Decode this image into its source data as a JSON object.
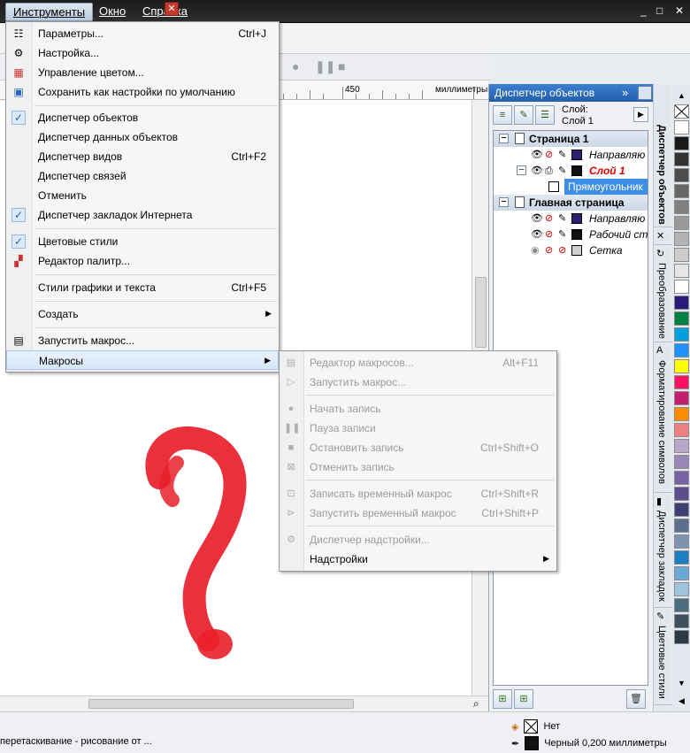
{
  "menubar": {
    "items": [
      "Инструменты",
      "Окно",
      "Справка"
    ],
    "controls": [
      "_",
      "□",
      "✕"
    ]
  },
  "ruler": {
    "mark": "450",
    "unit": "миллиметры"
  },
  "tools_menu": {
    "items": [
      {
        "label": "Параметры...",
        "shortcut": "Ctrl+J",
        "icon": "options-icon"
      },
      {
        "label": "Настройка...",
        "shortcut": "",
        "icon": "customize-icon"
      },
      {
        "label": "Управление цветом...",
        "shortcut": "",
        "icon": "color-management-icon"
      },
      {
        "label": "Сохранить как настройки по умолчанию",
        "shortcut": "",
        "icon": "save-defaults-icon"
      },
      {
        "label": "Диспетчер объектов",
        "shortcut": "",
        "icon": "check-icon",
        "checked": true
      },
      {
        "label": "Диспетчер данных объектов",
        "shortcut": ""
      },
      {
        "label": "Диспетчер видов",
        "shortcut": "Ctrl+F2"
      },
      {
        "label": "Диспетчер связей",
        "shortcut": ""
      },
      {
        "label": "Отменить",
        "shortcut": ""
      },
      {
        "label": "Диспетчер закладок Интернета",
        "shortcut": "",
        "icon": "check-icon",
        "checked": true
      },
      {
        "label": "Цветовые стили",
        "shortcut": "",
        "icon": "check-icon",
        "checked": true
      },
      {
        "label": "Редактор палитр...",
        "shortcut": "",
        "icon": "palette-editor-icon"
      },
      {
        "label": "Стили графики и текста",
        "shortcut": "Ctrl+F5"
      },
      {
        "label": "Создать",
        "shortcut": "",
        "submenu": true
      },
      {
        "label": "Запустить макрос...",
        "shortcut": "",
        "icon": "run-macro-icon"
      },
      {
        "label": "Макросы",
        "shortcut": "",
        "submenu": true
      }
    ]
  },
  "macro_menu": {
    "items": [
      {
        "label": "Редактор макросов...",
        "shortcut": "Alt+F11",
        "icon": "macro-editor-icon"
      },
      {
        "label": "Запустить макрос...",
        "shortcut": "",
        "icon": "play-icon"
      },
      {
        "label": "Начать запись",
        "shortcut": "",
        "icon": "record-icon"
      },
      {
        "label": "Пауза записи",
        "shortcut": "",
        "icon": "pause-icon"
      },
      {
        "label": "Остановить запись",
        "shortcut": "Ctrl+Shift+O",
        "icon": "stop-icon"
      },
      {
        "label": "Отменить запись",
        "shortcut": "",
        "icon": "cancel-record-icon"
      },
      {
        "label": "Записать временный макрос",
        "shortcut": "Ctrl+Shift+R",
        "icon": "record-temp-icon"
      },
      {
        "label": "Запустить временный макрос",
        "shortcut": "Ctrl+Shift+P",
        "icon": "run-temp-icon"
      },
      {
        "label": "Диспетчер надстройки...",
        "shortcut": "",
        "icon": "addon-manager-icon"
      },
      {
        "label": "Надстройки",
        "shortcut": "",
        "submenu": true
      }
    ]
  },
  "docker": {
    "title": "Диспетчер объектов",
    "layer_caption": "Слой:",
    "layer_name": "Слой 1",
    "tree": [
      {
        "type": "page",
        "label": "Страница 1"
      },
      {
        "type": "layer",
        "label": "Направляю",
        "color": "#2b1f73"
      },
      {
        "type": "layer",
        "label": "Слой 1",
        "color": "#111111",
        "active": true
      },
      {
        "type": "object",
        "label": "Прямоугольник",
        "selected": true
      },
      {
        "type": "page",
        "label": "Главная страница"
      },
      {
        "type": "layer",
        "label": "Направляю",
        "color": "#2b1f73"
      },
      {
        "type": "layer",
        "label": "Рабочий ст",
        "color": "#111111"
      },
      {
        "type": "layer",
        "label": "Сетка",
        "color": "#cfcfcf"
      }
    ]
  },
  "side_tabs": [
    "Диспетчер объектов",
    "Преобразование",
    "Форматирование символов",
    "Диспетчер закладок",
    "Цветовые стили"
  ],
  "status": {
    "hint": "перетаскивание - рисование от ...",
    "fill": "Нет",
    "stroke": "Черный  0,200 миллиметры"
  },
  "palette_colors": [
    "#ffffff",
    "#1a1a1a",
    "#333333",
    "#4d4d4d",
    "#666666",
    "#808080",
    "#999999",
    "#b3b3b3",
    "#cccccc",
    "#e6e6e6",
    "#ffffff",
    "#2a1a7a",
    "#008040",
    "#00a0e0",
    "#1e90ff",
    "#ffff00",
    "#ff1060",
    "#c41f6e",
    "#ff8c00",
    "#f08080",
    "#b9a7c9",
    "#9b86b8",
    "#7a63a3",
    "#5a4b8c",
    "#3e3f73",
    "#5c6f8f",
    "#7d93b0",
    "#1c7fc0",
    "#6aa9d8",
    "#9ec5dd",
    "#4a6e80",
    "#3c5060",
    "#2c3a45"
  ],
  "accent": "#2e6ec7"
}
